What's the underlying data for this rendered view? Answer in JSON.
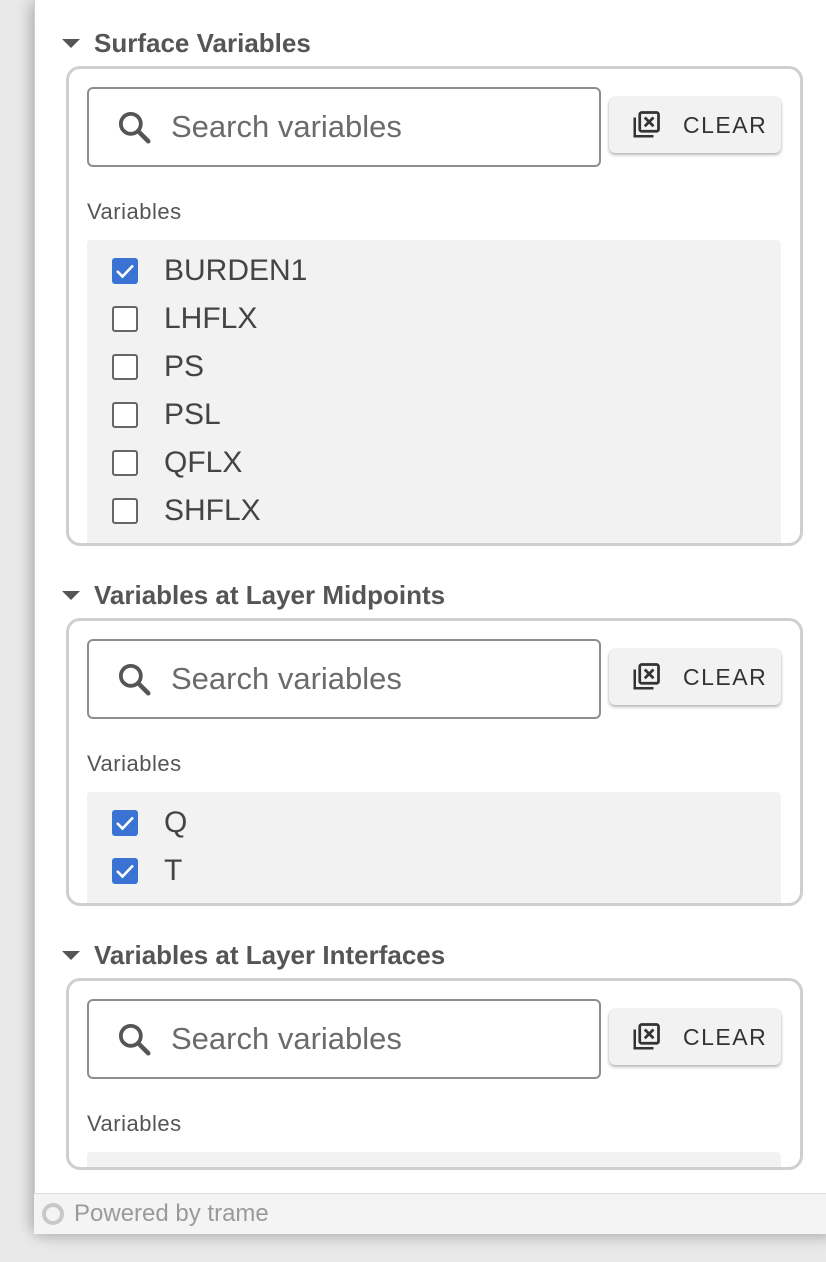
{
  "sections": [
    {
      "title": "Surface Variables",
      "search_placeholder": "Search variables",
      "clear_label": "CLEAR",
      "variables_label": "Variables",
      "items": [
        {
          "label": "BURDEN1",
          "checked": true
        },
        {
          "label": "LHFLX",
          "checked": false
        },
        {
          "label": "PS",
          "checked": false
        },
        {
          "label": "PSL",
          "checked": false
        },
        {
          "label": "QFLX",
          "checked": false
        },
        {
          "label": "SHFLX",
          "checked": false
        }
      ]
    },
    {
      "title": "Variables at Layer Midpoints",
      "search_placeholder": "Search variables",
      "clear_label": "CLEAR",
      "variables_label": "Variables",
      "items": [
        {
          "label": "Q",
          "checked": true
        },
        {
          "label": "T",
          "checked": true
        }
      ]
    },
    {
      "title": "Variables at Layer Interfaces",
      "search_placeholder": "Search variables",
      "clear_label": "CLEAR",
      "variables_label": "Variables",
      "items": []
    }
  ],
  "footer": {
    "text": "Powered by trame"
  },
  "colors": {
    "accent": "#3a73d3",
    "border": "#cfcfcf",
    "title": "#555555"
  },
  "icons": {
    "expand": "caret-down-icon",
    "search": "search-icon",
    "clear": "clear-filter-icon",
    "checkbox": "checkbox-icon",
    "logo": "trame-logo"
  }
}
